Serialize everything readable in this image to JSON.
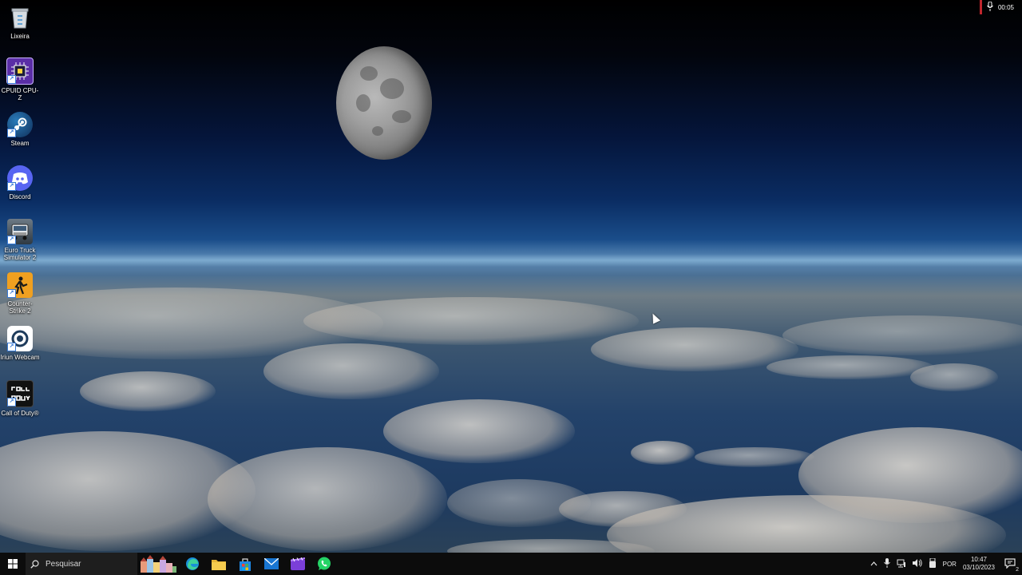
{
  "desktop": {
    "icons": [
      {
        "label": "Lixeira",
        "icon": "recycle-bin-icon"
      },
      {
        "label": "CPUID CPU-Z",
        "icon": "cpuz-icon"
      },
      {
        "label": "Steam",
        "icon": "steam-icon"
      },
      {
        "label": "Discord",
        "icon": "discord-icon"
      },
      {
        "label": "Euro Truck Simulator 2",
        "icon": "euro-truck-icon"
      },
      {
        "label": "Counter-Strike 2",
        "icon": "counter-strike-icon"
      },
      {
        "label": "Iriun Webcam",
        "icon": "iriun-webcam-icon"
      },
      {
        "label": "Call of Duty®",
        "icon": "call-of-duty-icon"
      }
    ],
    "recording": {
      "time": "00:05"
    }
  },
  "taskbar": {
    "search_placeholder": "Pesquisar",
    "pinned_apps": [
      "edge-icon",
      "file-explorer-icon",
      "store-icon",
      "mail-icon",
      "clipchamp-icon",
      "whatsapp-icon"
    ],
    "tray": {
      "language": "POR",
      "time": "10:47",
      "date": "03/10/2023",
      "notification_count": "2"
    }
  }
}
